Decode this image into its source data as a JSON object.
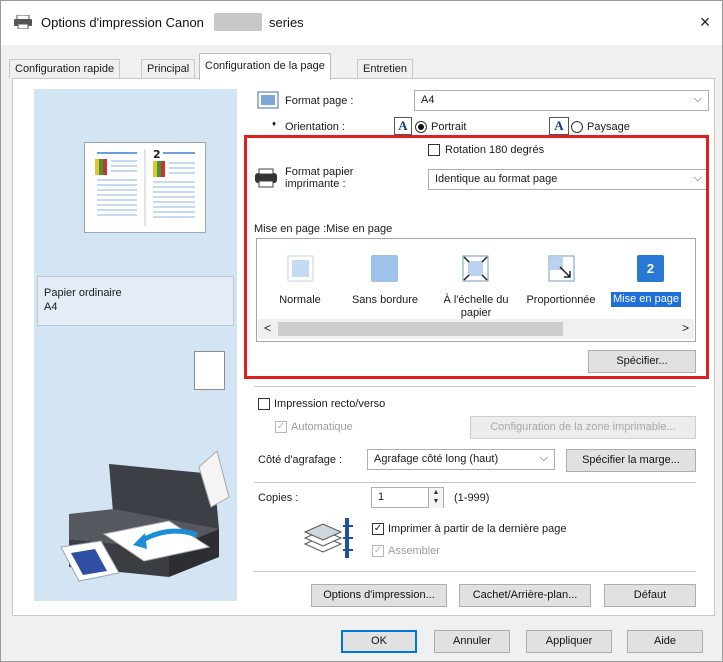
{
  "window": {
    "title": "Options d'impression Canon",
    "title_suffix": "series",
    "close_glyph": "×",
    "app_icon": "printer-icon"
  },
  "tabs": [
    {
      "label": "Configuration rapide",
      "active": false
    },
    {
      "label": "Principal",
      "active": false
    },
    {
      "label": "Configuration de la page",
      "active": true
    },
    {
      "label": "Entretien",
      "active": false
    }
  ],
  "preview": {
    "page_number": "2",
    "media_name": "Papier ordinaire",
    "media_size": "A4"
  },
  "page_setup": {
    "page_size_label": "Format page :",
    "page_size_value": "A4",
    "orientation_label": "Orientation :",
    "portrait_label": "Portrait",
    "landscape_label": "Paysage",
    "portrait_selected": true,
    "rotate_label": "Rotation 180 degrés",
    "rotate_checked": false,
    "printer_paper_label_1": "Format papier",
    "printer_paper_label_2": "imprimante :",
    "printer_paper_value": "Identique au format page",
    "orientation_icon_glyph": "A"
  },
  "layout_group": {
    "title": "Mise en page :Mise en page",
    "items": [
      {
        "label": "Normale",
        "icon": "normal-layout-icon"
      },
      {
        "label": "Sans bordure",
        "icon": "borderless-layout-icon"
      },
      {
        "label": "À l'échelle du",
        "label2": "papier",
        "icon": "fit-to-page-icon"
      },
      {
        "label": "Proportionnée",
        "icon": "scaled-layout-icon"
      },
      {
        "label": "Mise en page",
        "icon": "page-layout-icon",
        "selected": true,
        "glyph": "2"
      }
    ],
    "scroll_left": "<",
    "scroll_right": ">",
    "specify_button": "Spécifier..."
  },
  "duplex": {
    "label": "Impression recto/verso",
    "checked": false,
    "automatic_label": "Automatique",
    "automatic_checked": true,
    "print_area_button": "Configuration de la zone imprimable...",
    "stapling_label": "Côté d'agrafage :",
    "stapling_value": "Agrafage côté long (haut)",
    "margin_button": "Spécifier la marge..."
  },
  "copies": {
    "label": "Copies :",
    "value": "1",
    "range": "(1-999)",
    "last_page_label": "Imprimer à partir de la dernière page",
    "last_page_checked": true,
    "collate_label": "Assembler",
    "collate_checked": true
  },
  "bottom_buttons": {
    "print_options": "Options d'impression...",
    "stamp": "Cachet/Arrière-plan...",
    "defaults": "Défaut"
  },
  "dialog_buttons": {
    "ok": "OK",
    "cancel": "Annuler",
    "apply": "Appliquer",
    "help": "Aide"
  },
  "glyphs": {
    "check": "✓",
    "chevron_down": "⌵",
    "spin_up": "▲",
    "spin_down": "▼"
  },
  "colors": {
    "accent": "#1e6fd8",
    "highlight_frame": "#e02020",
    "preview_bg": "#d3e4f3"
  }
}
